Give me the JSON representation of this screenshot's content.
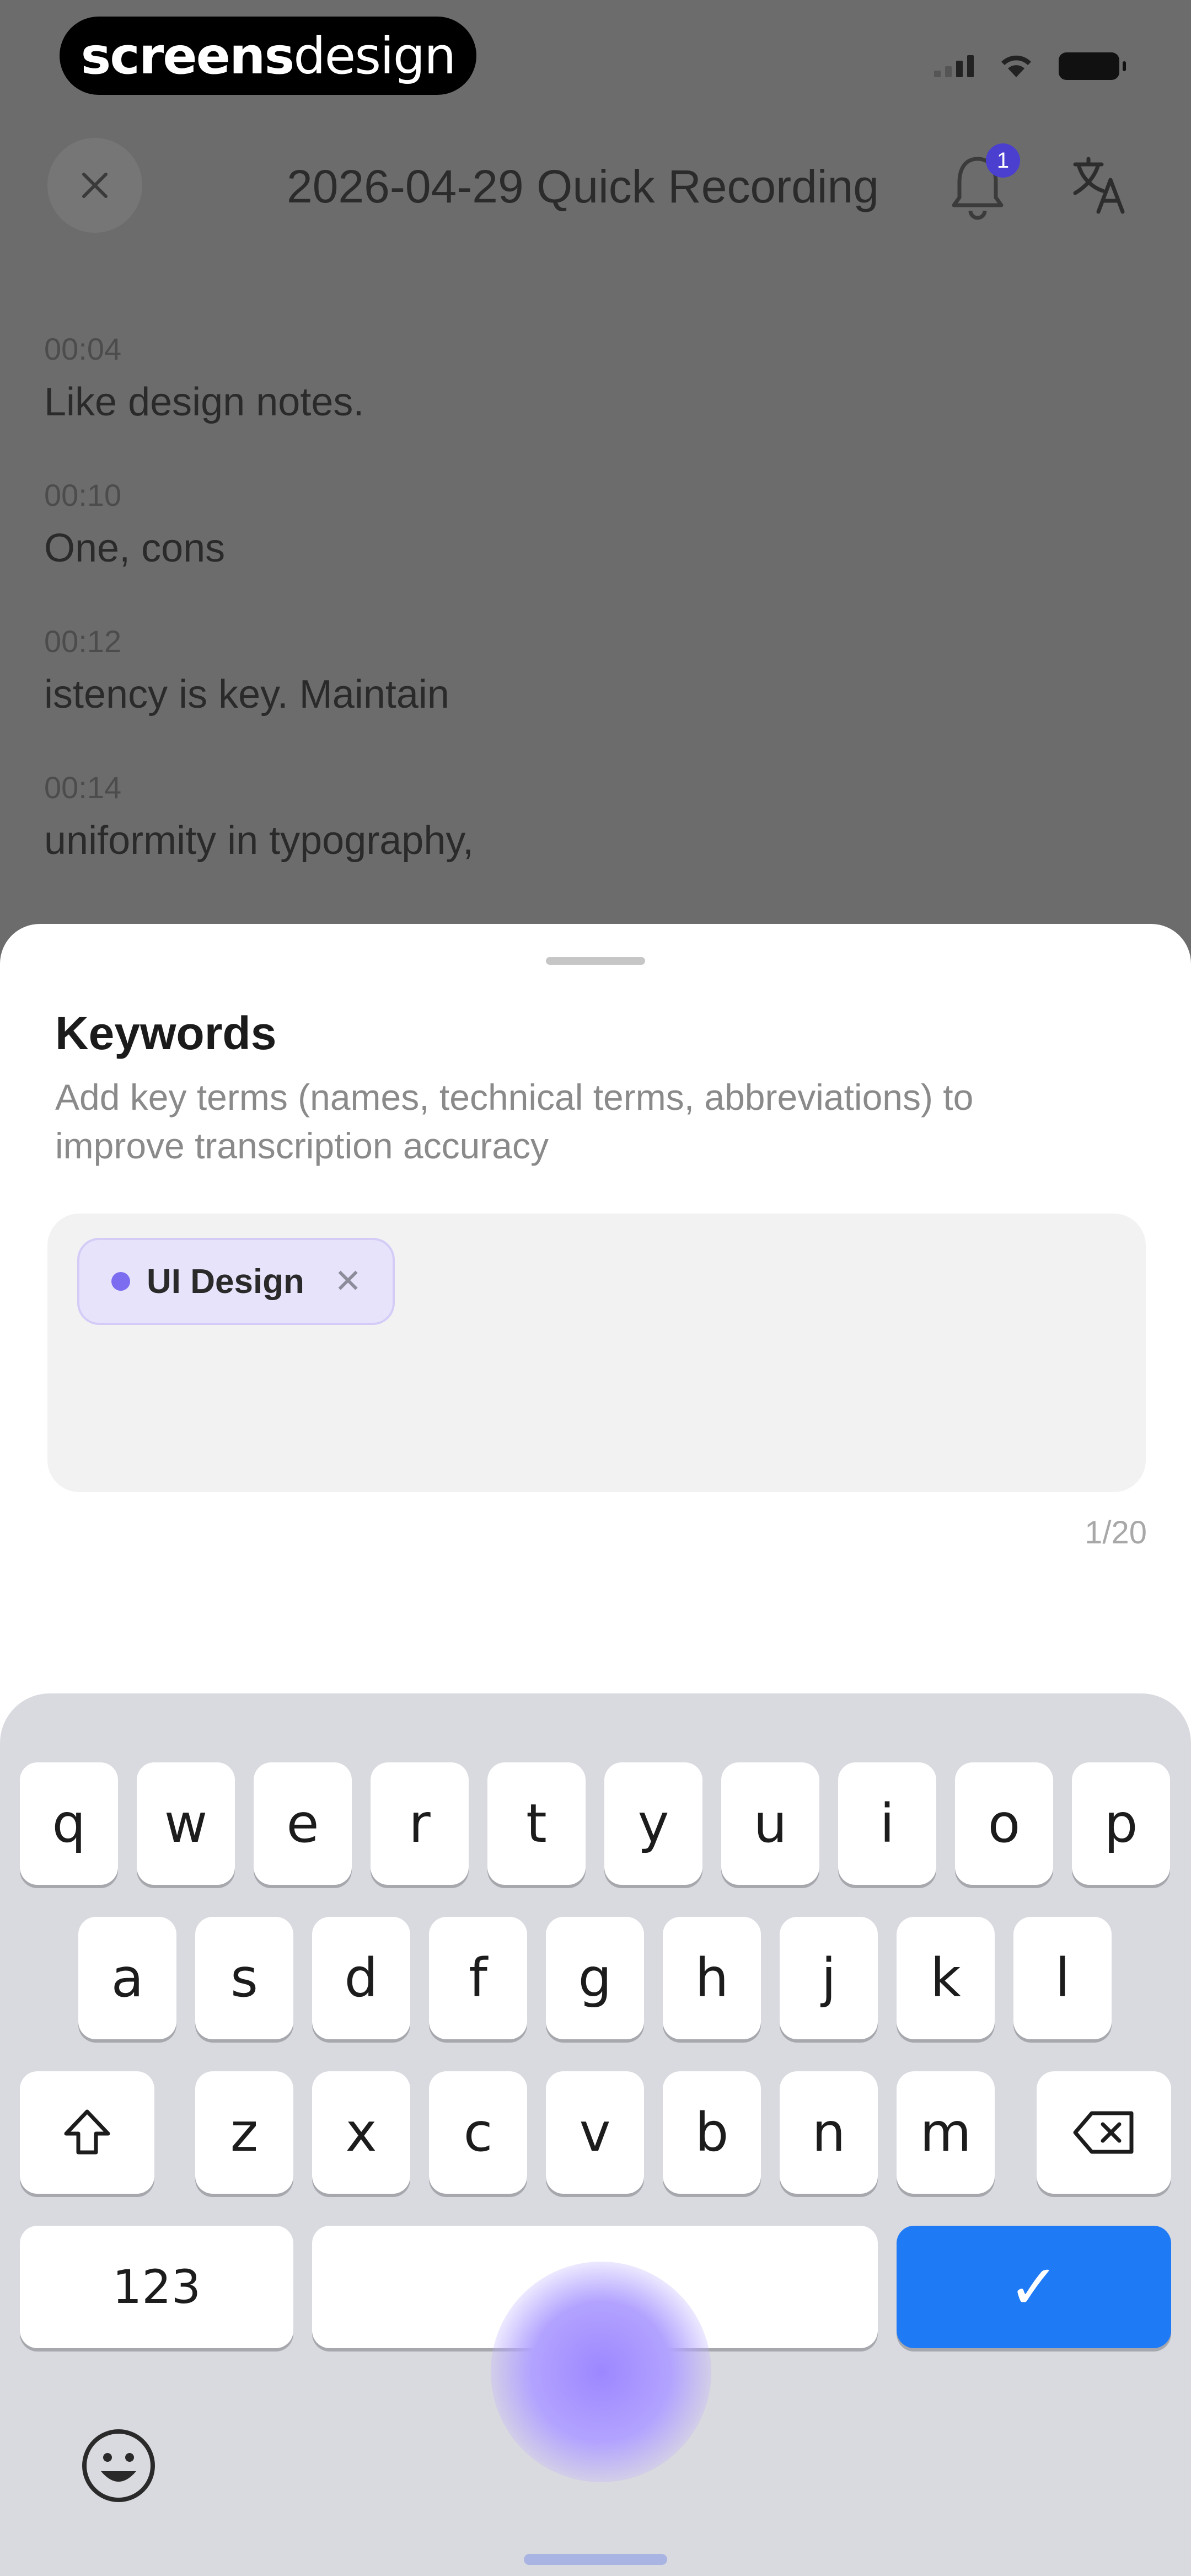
{
  "status_bar": {
    "brand_bold": "screens",
    "brand_light": "design"
  },
  "nav": {
    "title": "2026-04-29 Quick Recording",
    "notification_count": "1"
  },
  "transcript": [
    {
      "time": "00:04",
      "text": "Like design notes."
    },
    {
      "time": "00:10",
      "text": "One, cons"
    },
    {
      "time": "00:12",
      "text": "istency is key. Maintain"
    },
    {
      "time": "00:14",
      "text": "uniformity in typography,"
    }
  ],
  "sheet": {
    "title": "Keywords",
    "description": "Add key terms (names, technical terms, abbreviations) to improve transcription accuracy",
    "keywords": [
      {
        "label": "UI Design"
      }
    ],
    "counter": "1/20"
  },
  "keyboard": {
    "row1": [
      "q",
      "w",
      "e",
      "r",
      "t",
      "y",
      "u",
      "i",
      "o",
      "p"
    ],
    "row2": [
      "a",
      "s",
      "d",
      "f",
      "g",
      "h",
      "j",
      "k",
      "l"
    ],
    "row3": [
      "z",
      "x",
      "c",
      "v",
      "b",
      "n",
      "m"
    ],
    "numbers_label": "123",
    "space_label": "",
    "done_label": "✓"
  },
  "colors": {
    "accent": "#1f7af5",
    "chip_bg": "#e7e3fb",
    "chip_dot": "#7c6cf0",
    "badge": "#4b3fd0"
  }
}
